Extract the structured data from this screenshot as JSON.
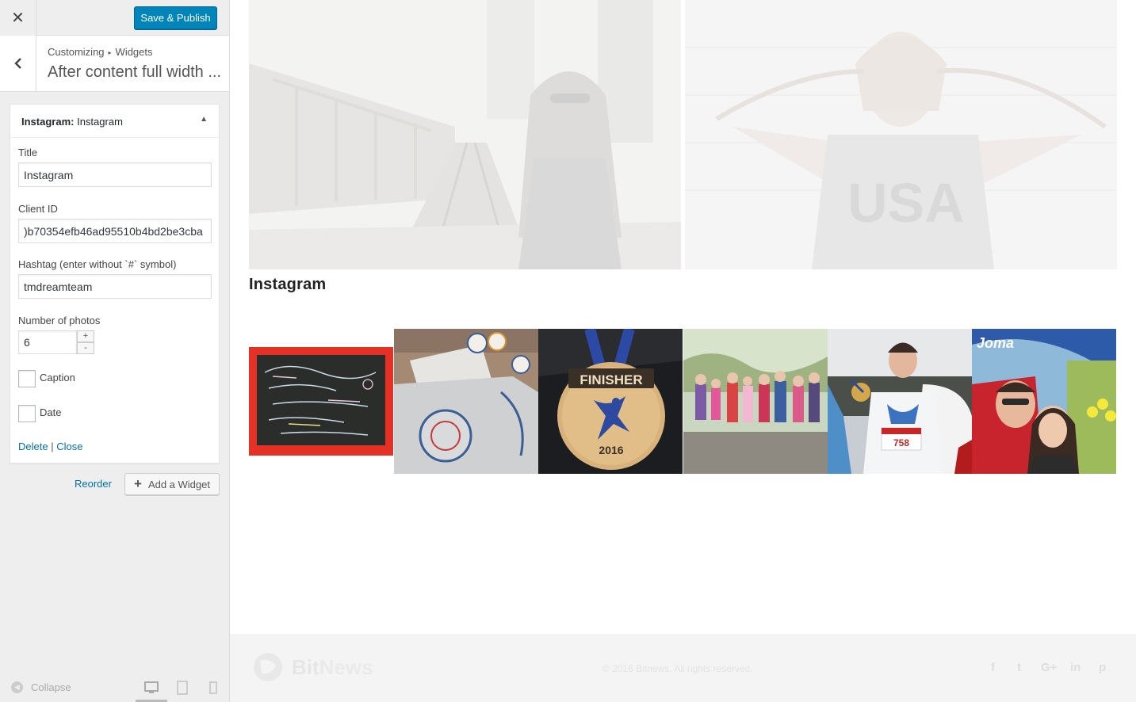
{
  "topbar": {
    "close_icon": "close-icon",
    "publish_label": "Save & Publish",
    "publish_color": "#0085ba"
  },
  "section": {
    "breadcrumb_root": "Customizing",
    "breadcrumb_child": "Widgets",
    "title": "After content full width ..."
  },
  "widget": {
    "type_label": "Instagram:",
    "title": "Instagram",
    "fields": {
      "title_label": "Title",
      "title_value": "Instagram",
      "client_id_label": "Client ID",
      "client_id_value": ")b70354efb46ad95510b4bd2be3cba",
      "hashtag_label": "Hashtag (enter without `#` symbol)",
      "hashtag_value": "tmdreamteam",
      "photos_label": "Number of photos",
      "photos_value": "6",
      "spin_up": "+",
      "spin_down": "-",
      "caption_label": "Caption",
      "date_label": "Date"
    },
    "actions": {
      "delete": "Delete",
      "separator": "|",
      "close": "Close"
    }
  },
  "panel_actions": {
    "reorder": "Reorder",
    "add_widget": "Add a Widget",
    "add_widget_icon": "plus-icon"
  },
  "bottom_bar": {
    "collapse": "Collapse",
    "devices": [
      "desktop-icon",
      "tablet-icon",
      "mobile-icon"
    ]
  },
  "preview": {
    "instagram_heading": "Instagram",
    "thumbnails": [
      {
        "name": "instagram-photo-chalkboard"
      },
      {
        "name": "instagram-photo-tshirts"
      },
      {
        "name": "instagram-photo-finisher-medal",
        "label_top": "FINISHER",
        "label_bottom": "2016"
      },
      {
        "name": "instagram-photo-kids-group"
      },
      {
        "name": "instagram-photo-runner-medal",
        "bib": "758"
      },
      {
        "name": "instagram-photo-selfie-couple",
        "brand": "Joma"
      }
    ],
    "hero_usa_text": "USA"
  },
  "site_footer": {
    "logo_part1": "Bit",
    "logo_part2": "News",
    "copyright": "© 2016 Bitnews. All rights reserved.",
    "social": [
      "f",
      "t",
      "G+",
      "in",
      "p"
    ]
  }
}
